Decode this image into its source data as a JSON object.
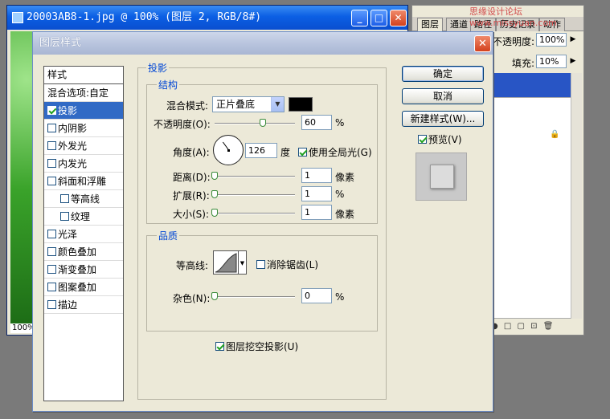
{
  "document": {
    "title": "20003AB8-1.jpg @ 100% (图层 2, RGB/8#)",
    "zoom": "100%",
    "btn_min": "_",
    "btn_max": "□",
    "btn_close": "✕"
  },
  "layers_panel": {
    "tabs": [
      "图层",
      "通道",
      "路径",
      "历史记录",
      "动作"
    ],
    "opacity_label": "不透明度:",
    "opacity_value": "100%",
    "fill_label": "填充:",
    "fill_value": "10%",
    "watermark": "思缘设计论坛 www.missyuan.com"
  },
  "dialog": {
    "title": "图层样式",
    "close": "✕",
    "style_list": {
      "header": "样式",
      "items": [
        {
          "label": "混合选项:自定",
          "checkbox": false,
          "checked": false,
          "active": false,
          "sub": false
        },
        {
          "label": "投影",
          "checkbox": true,
          "checked": true,
          "active": true,
          "sub": false
        },
        {
          "label": "内阴影",
          "checkbox": true,
          "checked": false,
          "active": false,
          "sub": false
        },
        {
          "label": "外发光",
          "checkbox": true,
          "checked": false,
          "active": false,
          "sub": false
        },
        {
          "label": "内发光",
          "checkbox": true,
          "checked": false,
          "active": false,
          "sub": false
        },
        {
          "label": "斜面和浮雕",
          "checkbox": true,
          "checked": false,
          "active": false,
          "sub": false
        },
        {
          "label": "等高线",
          "checkbox": true,
          "checked": false,
          "active": false,
          "sub": true
        },
        {
          "label": "纹理",
          "checkbox": true,
          "checked": false,
          "active": false,
          "sub": true
        },
        {
          "label": "光泽",
          "checkbox": true,
          "checked": false,
          "active": false,
          "sub": false
        },
        {
          "label": "颜色叠加",
          "checkbox": true,
          "checked": false,
          "active": false,
          "sub": false
        },
        {
          "label": "渐变叠加",
          "checkbox": true,
          "checked": false,
          "active": false,
          "sub": false
        },
        {
          "label": "图案叠加",
          "checkbox": true,
          "checked": false,
          "active": false,
          "sub": false
        },
        {
          "label": "描边",
          "checkbox": true,
          "checked": false,
          "active": false,
          "sub": false
        }
      ]
    },
    "drop_shadow": {
      "section": "投影",
      "structure": {
        "legend": "结构",
        "blend_mode_label": "混合模式:",
        "blend_mode_value": "正片叠底",
        "shadow_color": "#000000",
        "opacity_label": "不透明度(O):",
        "opacity_value": "60",
        "opacity_unit": "%",
        "opacity_level": 0.6,
        "angle_label": "角度(A):",
        "angle_value": "126",
        "angle_unit": "度",
        "global_light_label": "使用全局光(G)",
        "global_light_checked": true,
        "distance_label": "距离(D):",
        "distance_value": "1",
        "distance_unit": "像素",
        "spread_label": "扩展(R):",
        "spread_value": "1",
        "spread_unit": "%",
        "size_label": "大小(S):",
        "size_value": "1",
        "size_unit": "像素"
      },
      "quality": {
        "legend": "品质",
        "contour_label": "等高线:",
        "anti_alias_label": "消除锯齿(L)",
        "anti_alias_checked": false,
        "noise_label": "杂色(N):",
        "noise_value": "0",
        "noise_unit": "%"
      },
      "knockout_label": "图层挖空投影(U)",
      "knockout_checked": true
    },
    "buttons": {
      "ok": "确定",
      "cancel": "取消",
      "new_style": "新建样式(W)...",
      "preview_label": "预览(V)",
      "preview_checked": true
    }
  }
}
